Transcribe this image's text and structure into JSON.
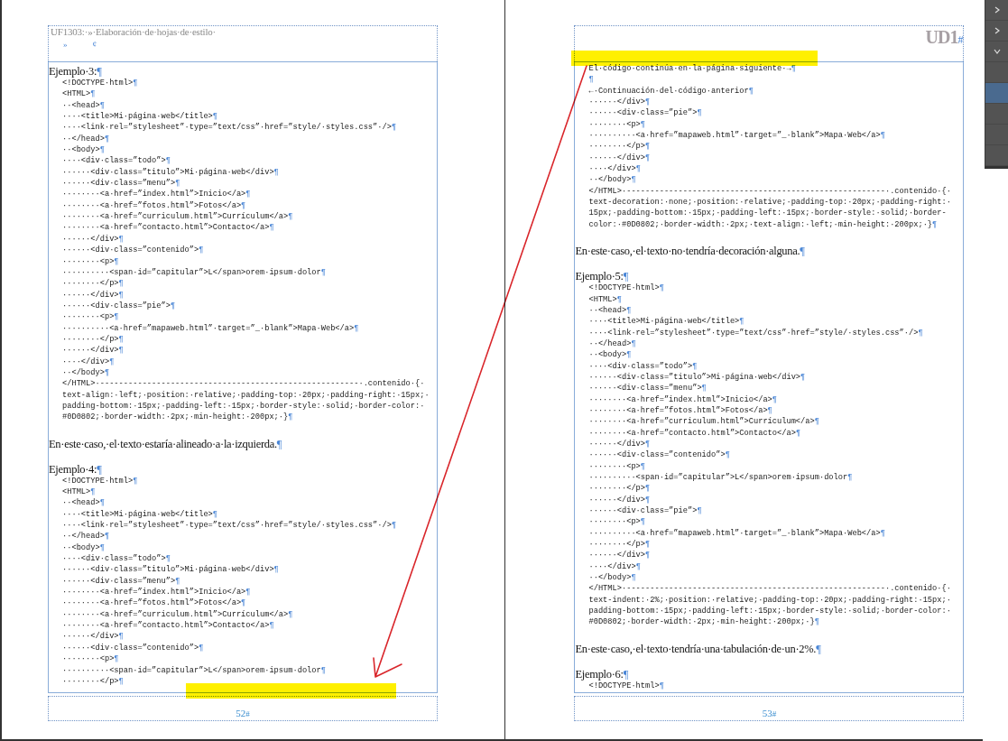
{
  "pages": [
    {
      "header": {
        "title": "UF1303:·»·Elaboración·de·hojas·de·estilo·",
        "marks": [
          "»",
          "¢"
        ]
      },
      "blocks": [
        {
          "kind": "heading",
          "text": "Ejemplo·3:",
          "mark": "¶"
        },
        {
          "kind": "code",
          "lines": [
            {
              "text": "<!DOCTYPE·html>",
              "mark": "¶"
            },
            {
              "text": "<HTML>",
              "mark": "¶"
            },
            {
              "text": "··<head>",
              "mark": "¶"
            },
            {
              "text": "····<title>Mi·página·web</title>",
              "mark": "¶"
            },
            {
              "text": "····<link·rel=”stylesheet”·type=”text/css”·href=”style/·styles.css”·/>",
              "mark": "¶"
            },
            {
              "text": "··</head>",
              "mark": "¶"
            },
            {
              "text": "··<body>",
              "mark": "¶"
            },
            {
              "text": "····<div·class=”todo”>",
              "mark": "¶"
            },
            {
              "text": "······<div·class=”titulo”>Mi·página·web</div>",
              "mark": "¶"
            },
            {
              "text": "······<div·class=”menu”>",
              "mark": "¶"
            },
            {
              "text": "········<a·href=”index.html”>Inicio</a>",
              "mark": "¶"
            },
            {
              "text": "········<a·href=”fotos.html”>Fotos</a>",
              "mark": "¶"
            },
            {
              "text": "········<a·href=”curriculum.html”>Currículum</a>",
              "mark": "¶"
            },
            {
              "text": "········<a·href=”contacto.html”>Contacto</a>",
              "mark": "¶"
            },
            {
              "text": "······</div>",
              "mark": "¶"
            },
            {
              "text": "······<div·class=”contenido”>",
              "mark": "¶"
            },
            {
              "text": "········<p>",
              "mark": "¶"
            },
            {
              "text": "··········<span·id=”capitular”>L</span>orem·ipsum·dolor",
              "mark": "¶"
            },
            {
              "text": "········</p>",
              "mark": "¶"
            },
            {
              "text": "······</div>",
              "mark": "¶"
            },
            {
              "text": "······<div·class=”pie”>",
              "mark": "¶"
            },
            {
              "text": "········<p>",
              "mark": "¶"
            },
            {
              "text": "··········<a·href=”mapaweb.html”·target=”_·blank”>Mapa·Web</a>",
              "mark": "¶"
            },
            {
              "text": "········</p>",
              "mark": "¶"
            },
            {
              "text": "······</div>",
              "mark": "¶"
            },
            {
              "text": "····</div>",
              "mark": "¶"
            },
            {
              "text": "··</body>",
              "mark": "¶"
            },
            {
              "text": "</HTML>·-------------------------------------------------------·.contenido·{·"
            },
            {
              "text": "text-align:·left;·position:·relative;·padding-top:·20px;·padding-right:·15px;·"
            },
            {
              "text": "padding-bottom:·15px;·padding-left:·15px;·border-style:·solid;·border-color:·"
            },
            {
              "text": "#0D0802;·border-width:·2px;·min-height:·200px;·}",
              "mark": "¶"
            }
          ]
        },
        {
          "kind": "prose",
          "text": "En·este·caso,·el·texto·estaría·alineado·a·la·izquierda.",
          "mark": "¶"
        },
        {
          "kind": "heading",
          "text": "Ejemplo·4:",
          "mark": "¶"
        },
        {
          "kind": "code",
          "lines": [
            {
              "text": "<!DOCTYPE·html>",
              "mark": "¶"
            },
            {
              "text": "<HTML>",
              "mark": "¶"
            },
            {
              "text": "··<head>",
              "mark": "¶"
            },
            {
              "text": "····<title>Mi·página·web</title>",
              "mark": "¶"
            },
            {
              "text": "····<link·rel=”stylesheet”·type=”text/css”·href=”style/·styles.css”·/>",
              "mark": "¶"
            },
            {
              "text": "··</head>",
              "mark": "¶"
            },
            {
              "text": "··<body>",
              "mark": "¶"
            },
            {
              "text": "····<div·class=”todo”>",
              "mark": "¶"
            },
            {
              "text": "······<div·class=”titulo”>Mi·página·web</div>",
              "mark": "¶"
            },
            {
              "text": "······<div·class=”menu”>",
              "mark": "¶"
            },
            {
              "text": "········<a·href=”index.html”>Inicio</a>",
              "mark": "¶"
            },
            {
              "text": "········<a·href=”fotos.html”>Fotos</a>",
              "mark": "¶"
            },
            {
              "text": "········<a·href=”curriculum.html”>Currículum</a>",
              "mark": "¶"
            },
            {
              "text": "········<a·href=”contacto.html”>Contacto</a>",
              "mark": "¶"
            },
            {
              "text": "······</div>",
              "mark": "¶"
            },
            {
              "text": "······<div·class=”contenido”>",
              "mark": "¶"
            },
            {
              "text": "········<p>",
              "mark": "¶"
            },
            {
              "text": "··········<span·id=”capitular”>L</span>orem·ipsum·dolor",
              "mark": "¶"
            },
            {
              "text": "········</p>",
              "mark": "¶"
            }
          ]
        }
      ],
      "footer": {
        "page_number": "52",
        "mark": "#"
      }
    },
    {
      "header": {
        "unit": "UD1",
        "mark": "#"
      },
      "blocks": [
        {
          "kind": "code",
          "lines": [
            {
              "text": "El·código·continúa·en·la·página·siguiente·→",
              "mark": "¶"
            },
            {
              "mark": "¶"
            },
            {
              "text": "←·Continuación·del·código·anterior",
              "mark": "¶"
            },
            {
              "text": "······</div>",
              "mark": "¶"
            },
            {
              "text": "······<div·class=”pie”>",
              "mark": "¶"
            },
            {
              "text": "········<p>",
              "mark": "¶"
            },
            {
              "text": "··········<a·href=”mapaweb.html”·target=”_·blank”>Mapa·Web</a>",
              "mark": "¶"
            },
            {
              "text": "········</p>",
              "mark": "¶"
            },
            {
              "text": "······</div>",
              "mark": "¶"
            },
            {
              "text": "····</div>",
              "mark": "¶"
            },
            {
              "text": "··</body>",
              "mark": "¶"
            },
            {
              "text": "</HTML>·-------------------------------------------------------·.contenido·{·"
            },
            {
              "text": "text-decoration:·none;·position:·relative;·padding-top:·20px;·padding-right:·"
            },
            {
              "text": "15px;·padding-bottom:·15px;·padding-left:·15px;·border-style:·solid;·border-"
            },
            {
              "text": "color:·#0D0802;·border-width:·2px;·text-align:·left;·min-height:·200px;·}",
              "mark": "¶"
            }
          ]
        },
        {
          "kind": "prose",
          "text": "En·este·caso,·el·texto·no·tendría·decoración·alguna.",
          "mark": "¶"
        },
        {
          "kind": "heading",
          "text": "Ejemplo·5:",
          "mark": "¶"
        },
        {
          "kind": "code",
          "lines": [
            {
              "text": "<!DOCTYPE·html>",
              "mark": "¶"
            },
            {
              "text": "<HTML>",
              "mark": "¶"
            },
            {
              "text": "··<head>",
              "mark": "¶"
            },
            {
              "text": "····<title>Mi·página·web</title>",
              "mark": "¶"
            },
            {
              "text": "····<link·rel=”stylesheet”·type=”text/css”·href=”style/·styles.css”·/>",
              "mark": "¶"
            },
            {
              "text": "··</head>",
              "mark": "¶"
            },
            {
              "text": "··<body>",
              "mark": "¶"
            },
            {
              "text": "····<div·class=”todo”>",
              "mark": "¶"
            },
            {
              "text": "······<div·class=”titulo”>Mi·página·web</div>",
              "mark": "¶"
            },
            {
              "text": "······<div·class=”menu”>",
              "mark": "¶"
            },
            {
              "text": "········<a·href=”index.html”>Inicio</a>",
              "mark": "¶"
            },
            {
              "text": "········<a·href=”fotos.html”>Fotos</a>",
              "mark": "¶"
            },
            {
              "text": "········<a·href=”curriculum.html”>Currículum</a>",
              "mark": "¶"
            },
            {
              "text": "········<a·href=”contacto.html”>Contacto</a>",
              "mark": "¶"
            },
            {
              "text": "······</div>",
              "mark": "¶"
            },
            {
              "text": "······<div·class=”contenido”>",
              "mark": "¶"
            },
            {
              "text": "········<p>",
              "mark": "¶"
            },
            {
              "text": "··········<span·id=”capitular”>L</span>orem·ipsum·dolor",
              "mark": "¶"
            },
            {
              "text": "········</p>",
              "mark": "¶"
            },
            {
              "text": "······</div>",
              "mark": "¶"
            },
            {
              "text": "······<div·class=”pie”>",
              "mark": "¶"
            },
            {
              "text": "········<p>",
              "mark": "¶"
            },
            {
              "text": "··········<a·href=”mapaweb.html”·target=”_·blank”>Mapa·Web</a>",
              "mark": "¶"
            },
            {
              "text": "········</p>",
              "mark": "¶"
            },
            {
              "text": "······</div>",
              "mark": "¶"
            },
            {
              "text": "····</div>",
              "mark": "¶"
            },
            {
              "text": "··</body>",
              "mark": "¶"
            },
            {
              "text": "</HTML>·-------------------------------------------------------·.contenido·{·"
            },
            {
              "text": "text-indent:·2%;·position:·relative;·padding-top:·20px;·padding-right:·15px;·"
            },
            {
              "text": "padding-bottom:·15px;·padding-left:·15px;·border-style:·solid;·border-color:·"
            },
            {
              "text": "#0D0802;·border-width:·2px;·min-height:·200px;·}",
              "mark": "¶"
            }
          ]
        },
        {
          "kind": "prose",
          "text": "En·este·caso,·el·texto·tendría·una·tabulación·de·un·2%.",
          "mark": "¶"
        },
        {
          "kind": "heading",
          "text": "Ejemplo·6:",
          "mark": "¶"
        },
        {
          "kind": "code",
          "lines": [
            {
              "text": "<!DOCTYPE·html>",
              "mark": "¶"
            }
          ]
        }
      ],
      "footer": {
        "page_number": "53",
        "mark": "#"
      }
    }
  ],
  "side_panel": {
    "items": [
      {
        "kind": "collapsed"
      },
      {
        "kind": "collapsed"
      },
      {
        "kind": "expanded"
      },
      {
        "kind": "blank"
      },
      {
        "kind": "blank",
        "selected": true
      },
      {
        "kind": "blank"
      },
      {
        "kind": "blank"
      },
      {
        "kind": "blank"
      }
    ]
  }
}
